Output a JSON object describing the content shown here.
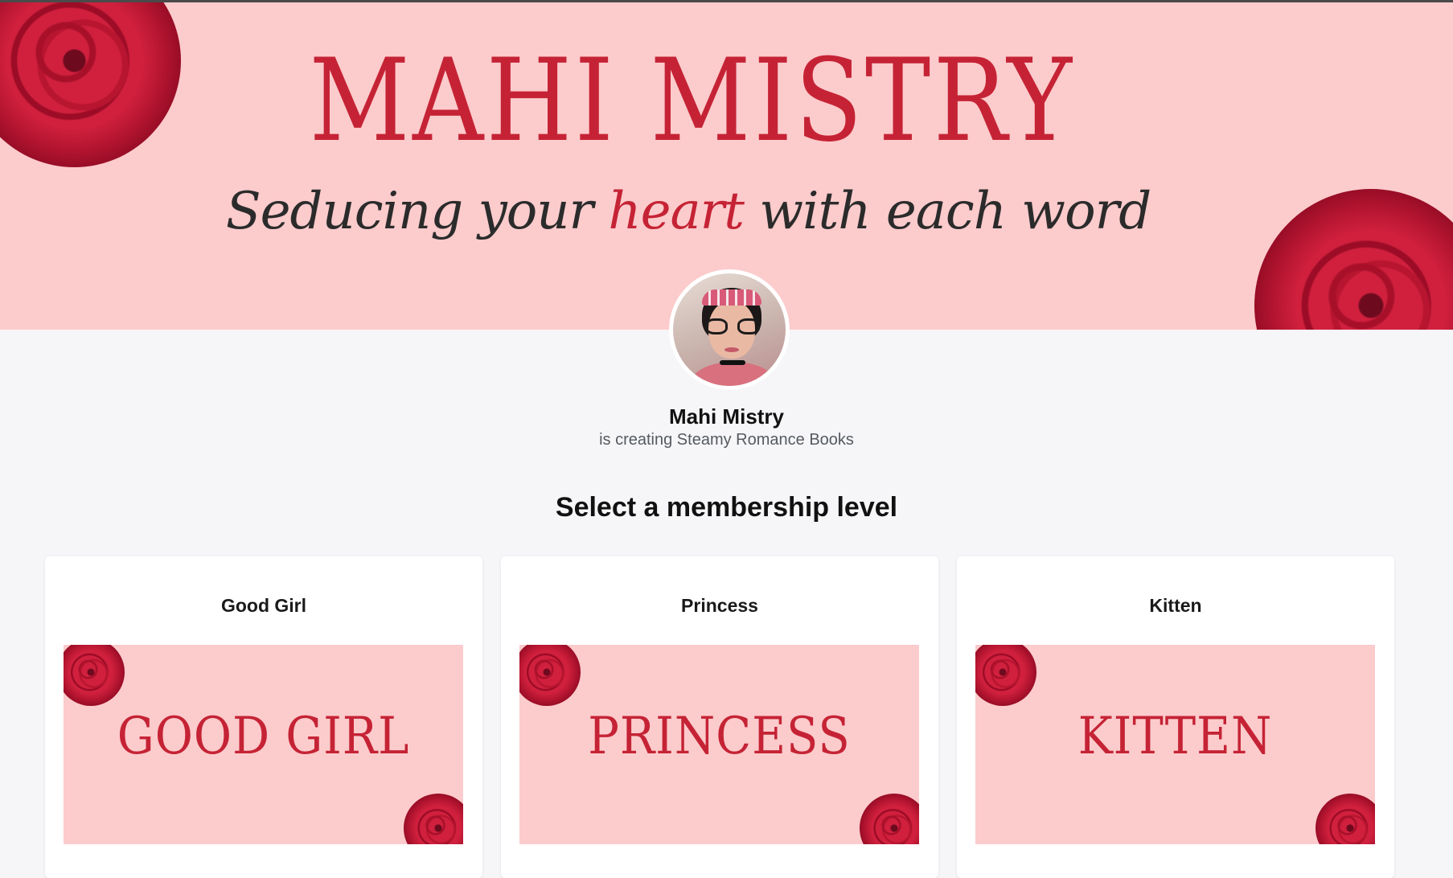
{
  "banner": {
    "title": "MAHI MISTRY",
    "tagline_start": "Seducing your ",
    "tagline_accent": "heart",
    "tagline_end": " with each word"
  },
  "creator": {
    "name": "Mahi Mistry",
    "subtitle": "is creating Steamy Romance Books"
  },
  "section_title": "Select a membership level",
  "tiers": [
    {
      "name": "Good Girl",
      "image_text": "GOOD GIRL"
    },
    {
      "name": "Princess",
      "image_text": "PRINCESS"
    },
    {
      "name": "Kitten",
      "image_text": "KITTEN"
    }
  ],
  "colors": {
    "banner_bg": "#fccbcc",
    "accent": "#c52335",
    "page_bg": "#f6f6f8"
  }
}
